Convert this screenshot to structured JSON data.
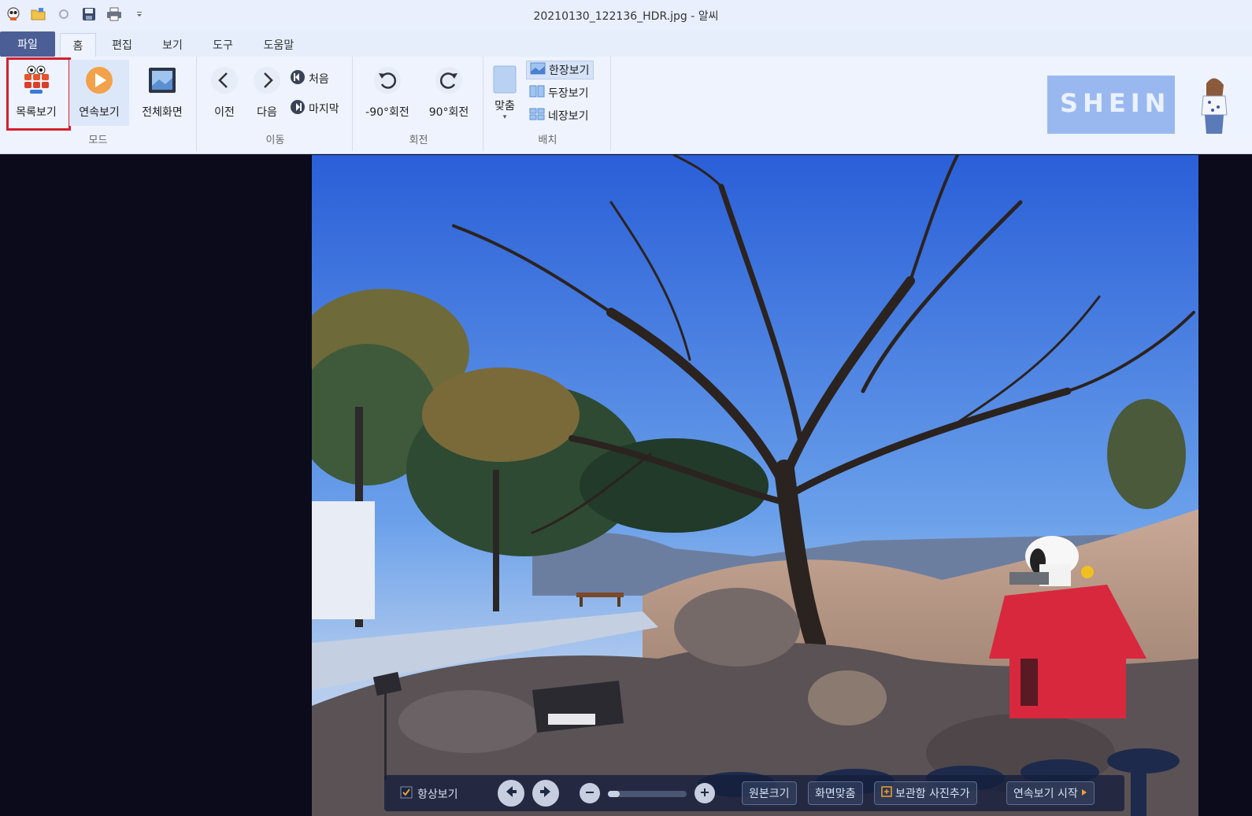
{
  "window": {
    "title": "20210130_122136_HDR.jpg - 알씨"
  },
  "quick_access": {
    "icons": [
      "alsee-logo-icon",
      "open-folder-icon",
      "settings-icon",
      "save-icon",
      "print-icon",
      "customize-dropdown-icon"
    ]
  },
  "tabs": [
    {
      "label": "파일"
    },
    {
      "label": "홈"
    },
    {
      "label": "편집"
    },
    {
      "label": "보기"
    },
    {
      "label": "도구"
    },
    {
      "label": "도움말"
    }
  ],
  "ribbon": {
    "mode": {
      "group_label": "모드",
      "list_view": "목록보기",
      "slideshow": "연속보기",
      "fullscreen": "전체화면"
    },
    "move": {
      "group_label": "이동",
      "prev": "이전",
      "next": "다음",
      "first": "처음",
      "last": "마지막"
    },
    "rotate": {
      "group_label": "회전",
      "ccw": "-90°회전",
      "cw": "90°회전"
    },
    "layout": {
      "group_label": "배치",
      "fit": "맞춤",
      "single": "한장보기",
      "double": "두장보기",
      "quad": "네장보기"
    }
  },
  "ad": {
    "brand": "SHEIN"
  },
  "overlay": {
    "always_show": "항상보기",
    "always_show_checked": true,
    "original_size": "원본크기",
    "fit_screen": "화면맞춤",
    "add_to_storage": "보관함 사진추가",
    "start_slideshow": "연속보기 시작",
    "zoom_level": 0.15
  },
  "colors": {
    "file_tab": "#4c5e96",
    "highlight_border": "#d42030",
    "ribbon_bg": "#eef3fd"
  }
}
